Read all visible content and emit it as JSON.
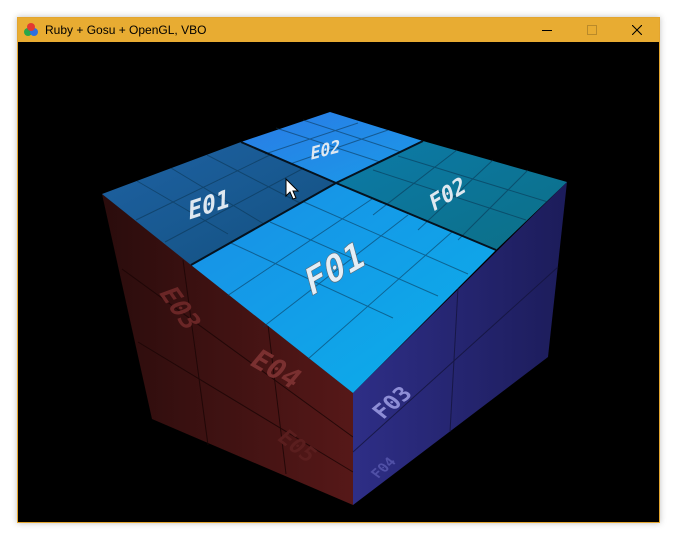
{
  "window": {
    "title": "Ruby + Gosu + OpenGL, VBO",
    "icon": "gosu-app-icon",
    "buttons": {
      "minimize": "minimize-icon",
      "maximize": "maximize-icon",
      "close": "close-icon"
    }
  },
  "scene": {
    "top_faces": {
      "front": "F01",
      "right": "F02",
      "left": "E01",
      "back": "E02"
    },
    "left_side_labels": {
      "upper": "E03",
      "middle": "E04",
      "lower": "E05"
    },
    "right_side_labels": {
      "upper": "F03",
      "lower": "F04"
    },
    "colors": {
      "window_border": "#e3a52f",
      "titlebar": "#e8ac32",
      "background": "#000000",
      "top_bright": "#0aa0e6",
      "top_dark": "#125a90",
      "left_side": "#4a1414",
      "right_side": "#2c2c78"
    },
    "cursor": "mouse-pointer-icon"
  }
}
